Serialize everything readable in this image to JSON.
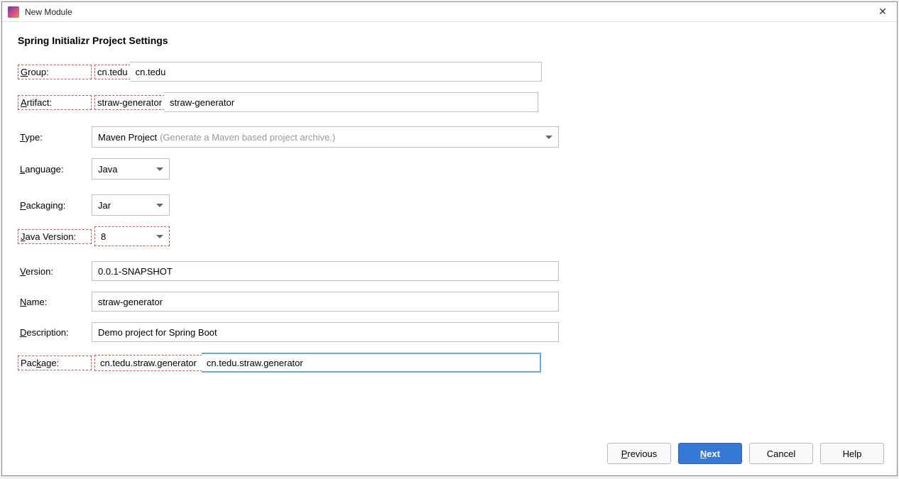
{
  "window": {
    "title": "New Module",
    "close_glyph": "✕"
  },
  "heading": "Spring Initializr Project Settings",
  "labels": {
    "group_u": "G",
    "group_rest": "roup:",
    "artifact_u": "A",
    "artifact_rest": "rtifact:",
    "type_u": "T",
    "type_rest": "ype:",
    "language_u": "L",
    "language_rest": "anguage:",
    "packaging_u": "P",
    "packaging_rest": "ackaging:",
    "javaver_u": "J",
    "javaver_rest": "ava Version:",
    "version_u": "V",
    "version_rest": "ersion:",
    "name_u": "N",
    "name_rest": "ame:",
    "description_u": "D",
    "description_rest": "escription:",
    "package_pre": "Pac",
    "package_u": "k",
    "package_rest": "age:"
  },
  "values": {
    "group": "cn.tedu",
    "artifact": "straw-generator",
    "type_main": "Maven Project",
    "type_hint": "(Generate a Maven based project archive.)",
    "language": "Java",
    "packaging": "Jar",
    "java_version": "8",
    "version": "0.0.1-SNAPSHOT",
    "name": "straw-generator",
    "description": "Demo project for Spring Boot",
    "package": "cn.tedu.straw.generator"
  },
  "buttons": {
    "previous_u": "P",
    "previous_rest": "revious",
    "next_u": "N",
    "next_rest": "ext",
    "cancel": "Cancel",
    "help": "Help"
  }
}
